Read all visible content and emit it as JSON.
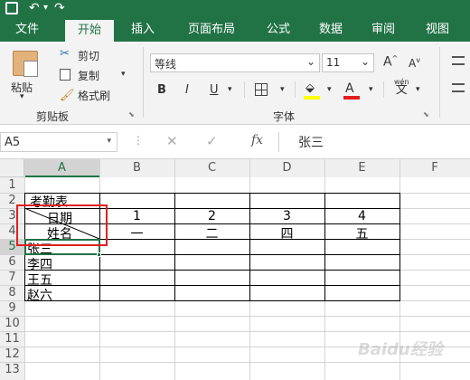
{
  "tabs": [
    {
      "label": "文件"
    },
    {
      "label": "开始"
    },
    {
      "label": "插入"
    },
    {
      "label": "页面布局"
    },
    {
      "label": "公式"
    },
    {
      "label": "数据"
    },
    {
      "label": "审阅"
    },
    {
      "label": "视图"
    }
  ],
  "active_tab": "开始",
  "clipboard": {
    "paste": "粘贴",
    "cut": "剪切",
    "copy": "复制",
    "format_painter": "格式刷",
    "group_label": "剪贴板"
  },
  "font": {
    "name": "等线",
    "size": "11",
    "group_label": "字体",
    "buttons": [
      "B",
      "I",
      "U"
    ],
    "increase": "A",
    "decrease": "A",
    "wen": "wén",
    "wen2": "文",
    "font_color_letter": "A"
  },
  "formula_bar": {
    "name_box": "A5",
    "fx": "fx",
    "value": "张三"
  },
  "colors": {
    "brand": "#217346",
    "red_box": "#e02020",
    "selection": "#217346"
  },
  "columns": [
    "A",
    "B",
    "C",
    "D",
    "E",
    "F"
  ],
  "rows": [
    "1",
    "2",
    "3",
    "4",
    "5",
    "6",
    "7",
    "8",
    "9",
    "10",
    "11",
    "12",
    "13"
  ],
  "cells": {
    "A2": "考勤表",
    "A3": "日期",
    "A4": "姓名",
    "B3": "1",
    "C3": "2",
    "D3": "3",
    "E3": "4",
    "B4": "一",
    "C4": "二",
    "D4": "四",
    "E4": "五",
    "A5": "张三",
    "A6": "李四",
    "A7": "王五",
    "A8": "赵六"
  },
  "watermark": "Baidu经验"
}
